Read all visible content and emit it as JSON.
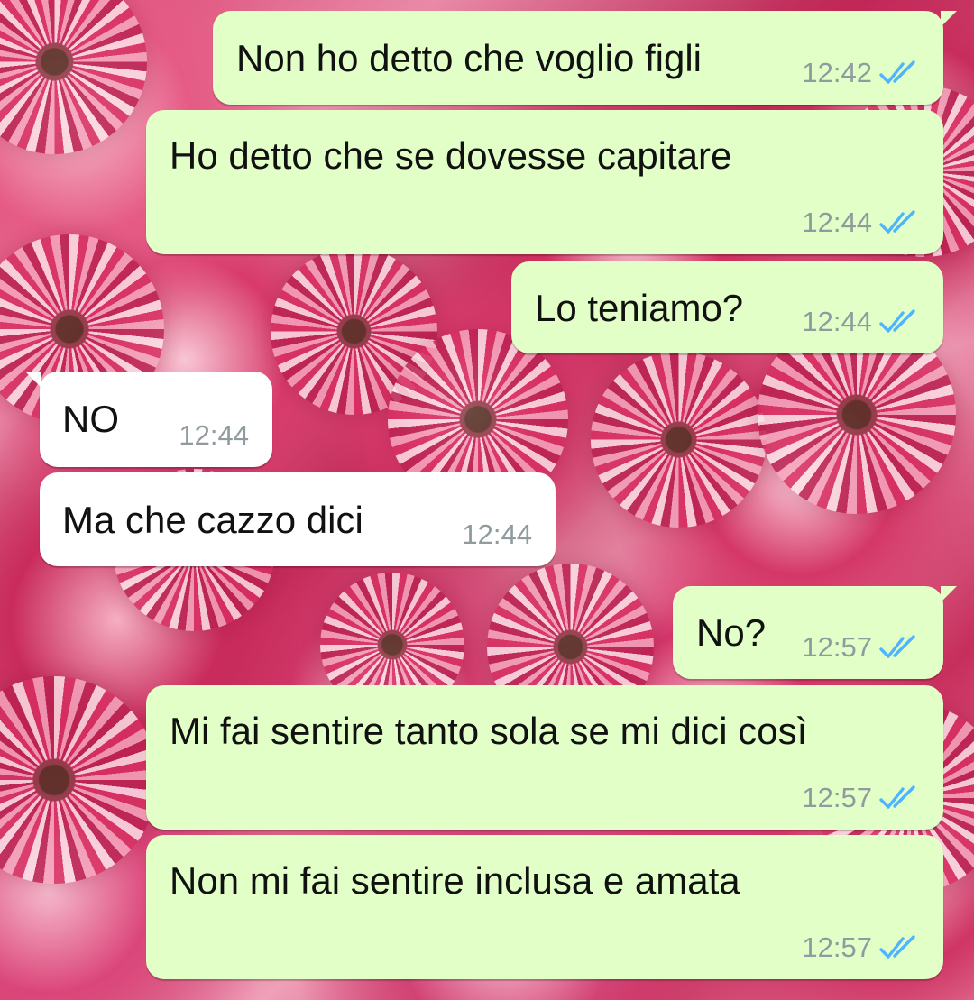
{
  "colors": {
    "outgoing_bubble": "#e1ffc7",
    "incoming_bubble": "#ffffff",
    "timestamp": "#8f9b9f",
    "read_receipt": "#4fb4ff"
  },
  "messages": [
    {
      "text": "Non ho detto che voglio figli",
      "time": "12:42",
      "direction": "outgoing",
      "status_icon": "double-check-read-icon"
    },
    {
      "text": "Ho detto che se dovesse capitare",
      "time": "12:44",
      "direction": "outgoing",
      "status_icon": "double-check-read-icon"
    },
    {
      "text": "Lo teniamo?",
      "time": "12:44",
      "direction": "outgoing",
      "status_icon": "double-check-read-icon"
    },
    {
      "text": "NO",
      "time": "12:44",
      "direction": "incoming"
    },
    {
      "text": "Ma che cazzo dici",
      "time": "12:44",
      "direction": "incoming"
    },
    {
      "text": "No?",
      "time": "12:57",
      "direction": "outgoing",
      "status_icon": "double-check-read-icon"
    },
    {
      "text": "Mi fai sentire tanto sola se mi dici così",
      "time": "12:57",
      "direction": "outgoing",
      "status_icon": "double-check-read-icon"
    },
    {
      "text": "Non mi fai sentire inclusa e amata",
      "time": "12:57",
      "direction": "outgoing",
      "status_icon": "double-check-read-icon"
    }
  ]
}
